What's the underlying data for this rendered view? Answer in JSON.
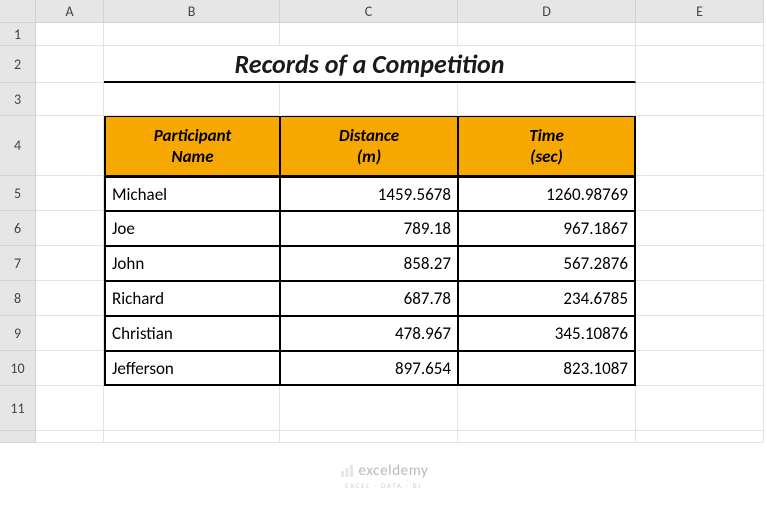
{
  "columns": [
    "A",
    "B",
    "C",
    "D",
    "E"
  ],
  "rows": [
    "1",
    "2",
    "3",
    "4",
    "5",
    "6",
    "7",
    "8",
    "9",
    "10",
    "11"
  ],
  "title": "Records of a Competition",
  "headers": {
    "participant": "Participant\nName",
    "distance": "Distance\n(m)",
    "time": "Time\n(sec)"
  },
  "data": [
    {
      "name": "Michael",
      "distance": "1459.5678",
      "time": "1260.98769"
    },
    {
      "name": "Joe",
      "distance": "789.18",
      "time": "967.1867"
    },
    {
      "name": "John",
      "distance": "858.27",
      "time": "567.2876"
    },
    {
      "name": "Richard",
      "distance": "687.78",
      "time": "234.6785"
    },
    {
      "name": "Christian",
      "distance": "478.967",
      "time": "345.10876"
    },
    {
      "name": "Jefferson",
      "distance": "897.654",
      "time": "823.1087"
    }
  ],
  "watermark": {
    "brand": "exceldemy",
    "tagline": "EXCEL · DATA · BI"
  },
  "chart_data": {
    "type": "table",
    "title": "Records of a Competition",
    "columns": [
      "Participant Name",
      "Distance (m)",
      "Time (sec)"
    ],
    "rows": [
      [
        "Michael",
        1459.5678,
        1260.98769
      ],
      [
        "Joe",
        789.18,
        967.1867
      ],
      [
        "John",
        858.27,
        567.2876
      ],
      [
        "Richard",
        687.78,
        234.6785
      ],
      [
        "Christian",
        478.967,
        345.10876
      ],
      [
        "Jefferson",
        897.654,
        823.1087
      ]
    ]
  }
}
